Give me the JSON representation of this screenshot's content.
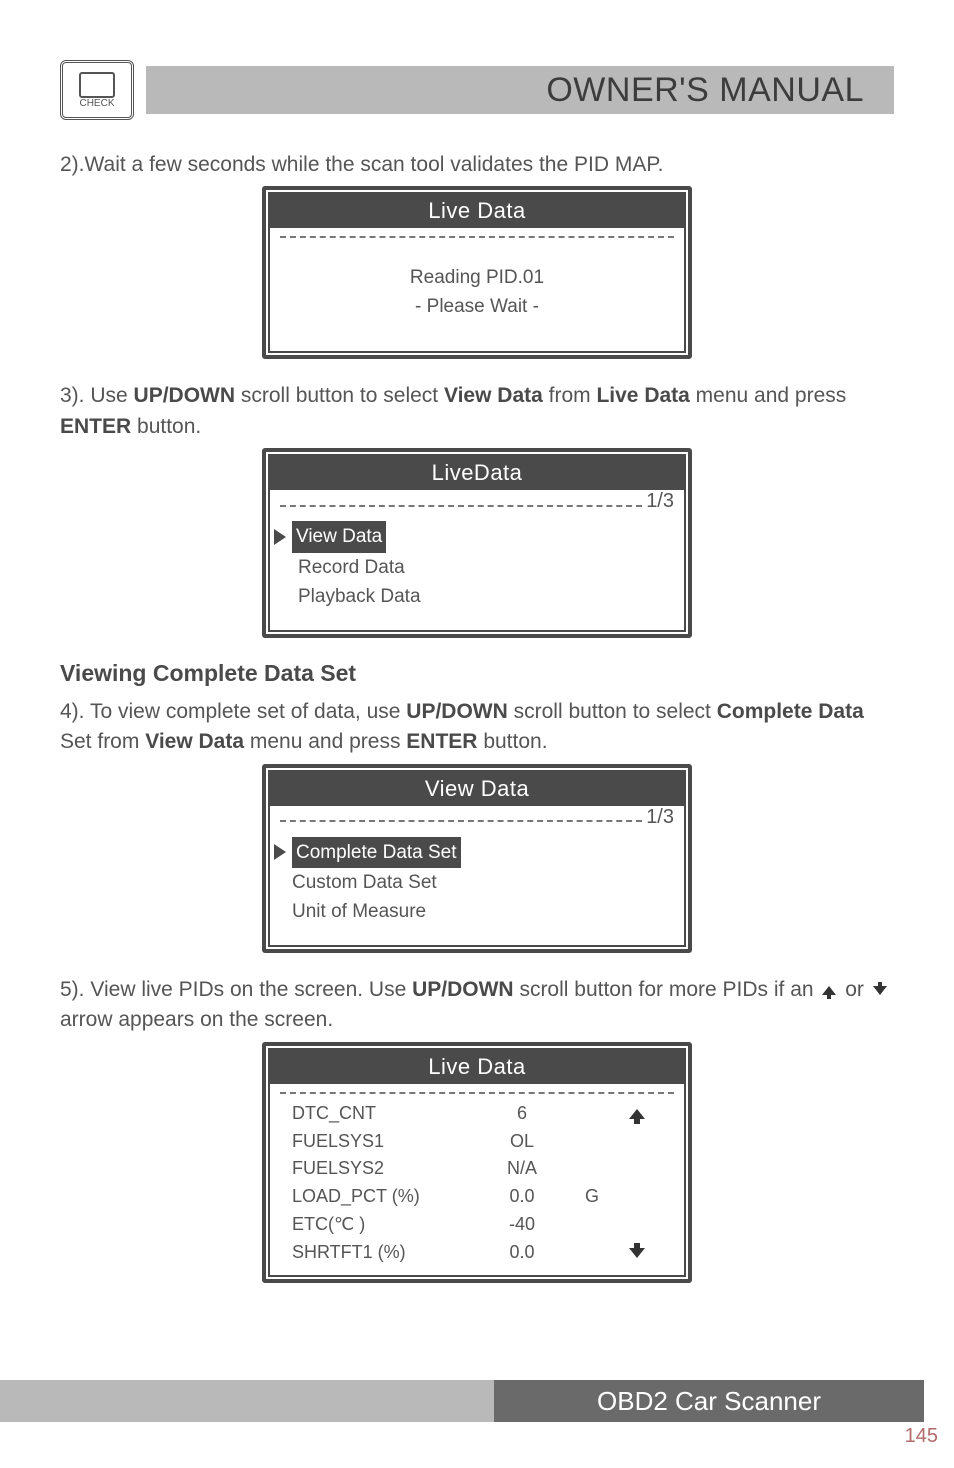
{
  "header": {
    "icon_label": "CHECK",
    "title": "OWNER'S MANUAL"
  },
  "step2": {
    "text": "2).Wait a few seconds while the scan tool validates the PID MAP."
  },
  "lcd1": {
    "title": "Live Data",
    "line1": "Reading PID.01",
    "line2": "- Please Wait -"
  },
  "step3": {
    "pre": "3). Use ",
    "b1": "UP/DOWN",
    "mid1": " scroll button to select ",
    "b2": "View Data",
    "mid2": " from ",
    "b3": "Live Data",
    "post1": " menu and press ",
    "b4": "ENTER",
    "post2": " button."
  },
  "lcd2": {
    "title": "LiveData",
    "page": "1/3",
    "items": [
      "View Data",
      "Record Data",
      "Playback Data"
    ]
  },
  "section_head": "Viewing Complete Data Set",
  "step4": {
    "pre": "4). To view complete set of data, use ",
    "b1": "UP/DOWN",
    "mid1": " scroll button to select ",
    "b2": "Complete Data",
    "mid2": " Set from ",
    "b3": "View Data",
    "mid3": " menu and press ",
    "b4": "ENTER",
    "post": " button."
  },
  "lcd3": {
    "title": "View Data",
    "page": "1/3",
    "items": [
      "Complete Data Set",
      "Custom Data Set",
      "Unit of Measure"
    ]
  },
  "step5": {
    "pre": "5). View live PIDs on the screen. Use ",
    "b1": "UP/DOWN",
    "mid": " scroll button for more PIDs if an ",
    "mid2": " or ",
    "post": " arrow appears on the screen."
  },
  "lcd4": {
    "title": "Live Data",
    "rows": [
      {
        "name": "DTC_CNT",
        "val": "6",
        "unit": "",
        "arrow": "up"
      },
      {
        "name": "FUELSYS1",
        "val": "OL",
        "unit": "",
        "arrow": ""
      },
      {
        "name": "FUELSYS2",
        "val": "N/A",
        "unit": "",
        "arrow": ""
      },
      {
        "name": "LOAD_PCT (%)",
        "val": "0.0",
        "unit": "G",
        "arrow": ""
      },
      {
        "name": "ETC(℃ )",
        "val": "-40",
        "unit": "",
        "arrow": ""
      },
      {
        "name": "SHRTFT1 (%)",
        "val": "0.0",
        "unit": "",
        "arrow": "down"
      }
    ]
  },
  "footer": {
    "product": "OBD2 Car Scanner",
    "page_number": "145"
  }
}
